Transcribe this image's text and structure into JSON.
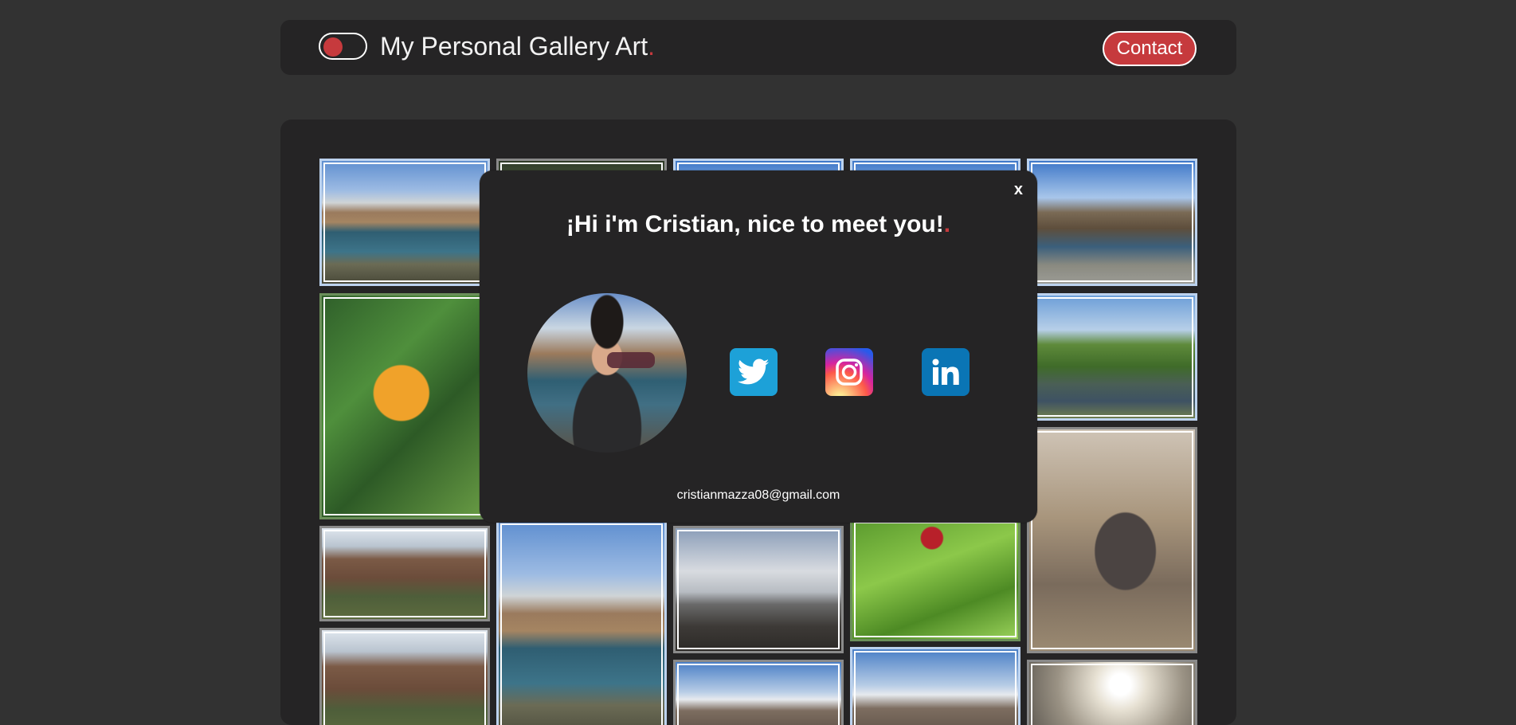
{
  "header": {
    "title": "My Personal Gallery Art",
    "title_dot": ".",
    "contact_label": "Contact",
    "toggle_icon": "theme-toggle-icon"
  },
  "modal": {
    "close_label": "x",
    "title": "¡Hi i'm Cristian, nice to meet you!",
    "title_dot": ".",
    "email": "cristianmazza08@gmail.com",
    "socials": [
      {
        "name": "twitter",
        "icon": "twitter-icon",
        "color": "#1da1d8"
      },
      {
        "name": "instagram",
        "icon": "instagram-icon",
        "color": "#d6249f"
      },
      {
        "name": "linkedin",
        "icon": "linkedin-icon",
        "color": "#0a75b5"
      }
    ]
  },
  "colors": {
    "background": "#323232",
    "panel": "#252425",
    "accent": "#c63a3d"
  }
}
